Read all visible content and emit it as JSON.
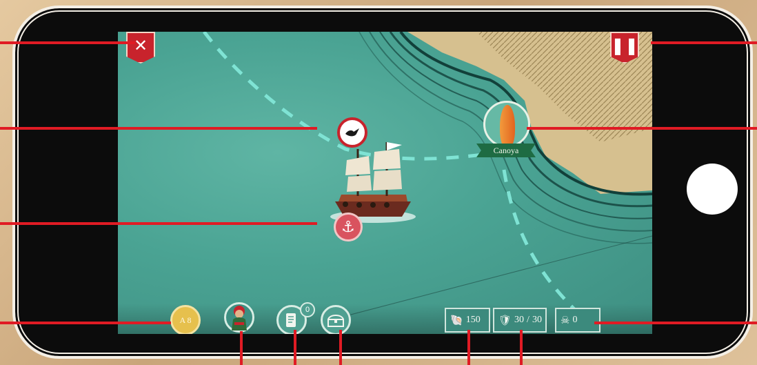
{
  "top_bar": {
    "close_icon": "close-x-icon",
    "pause_icon": "pause-icon"
  },
  "map": {
    "location_name": "Canoya",
    "ship_flag_icon": "dove-flag-icon",
    "anchor_icon": "anchor-icon"
  },
  "bottom_bar": {
    "level_label": "A 8",
    "captain_icon": "pirate-captain-icon",
    "quests_icon": "scroll-icon",
    "quest_count": "0",
    "cargo_icon": "chest-icon",
    "gold_value": "150",
    "health_value": "30",
    "health_max": "30",
    "kills_value": "0"
  },
  "colors": {
    "accent_red": "#c8232c",
    "sea": "#4aa393",
    "callout_red": "#e01b24"
  }
}
